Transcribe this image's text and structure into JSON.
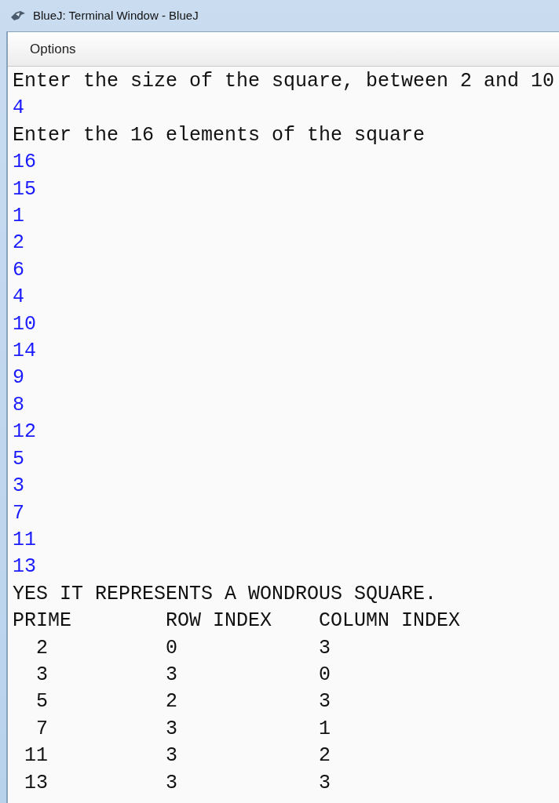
{
  "window": {
    "title": "BlueJ: Terminal Window - BlueJ"
  },
  "menu": [
    "Options"
  ],
  "terminal": [
    {
      "kind": "output",
      "text": "Enter the size of the square, between 2 and 10"
    },
    {
      "kind": "input",
      "text": "4"
    },
    {
      "kind": "output",
      "text": "Enter the 16 elements of the square"
    },
    {
      "kind": "input",
      "text": "16"
    },
    {
      "kind": "input",
      "text": "15"
    },
    {
      "kind": "input",
      "text": "1"
    },
    {
      "kind": "input",
      "text": "2"
    },
    {
      "kind": "input",
      "text": "6"
    },
    {
      "kind": "input",
      "text": "4"
    },
    {
      "kind": "input",
      "text": "10"
    },
    {
      "kind": "input",
      "text": "14"
    },
    {
      "kind": "input",
      "text": "9"
    },
    {
      "kind": "input",
      "text": "8"
    },
    {
      "kind": "input",
      "text": "12"
    },
    {
      "kind": "input",
      "text": "5"
    },
    {
      "kind": "input",
      "text": "3"
    },
    {
      "kind": "input",
      "text": "7"
    },
    {
      "kind": "input",
      "text": "11"
    },
    {
      "kind": "input",
      "text": "13"
    },
    {
      "kind": "output",
      "text": "YES IT REPRESENTS A WONDROUS SQUARE."
    },
    {
      "kind": "output",
      "text": "PRIME        ROW INDEX    COLUMN INDEX"
    },
    {
      "kind": "output",
      "text": "  2          0            3"
    },
    {
      "kind": "output",
      "text": "  3          3            0"
    },
    {
      "kind": "output",
      "text": "  5          2            3"
    },
    {
      "kind": "output",
      "text": "  7          3            1"
    },
    {
      "kind": "output",
      "text": " 11          3            2"
    },
    {
      "kind": "output",
      "text": " 13          3            3"
    }
  ]
}
